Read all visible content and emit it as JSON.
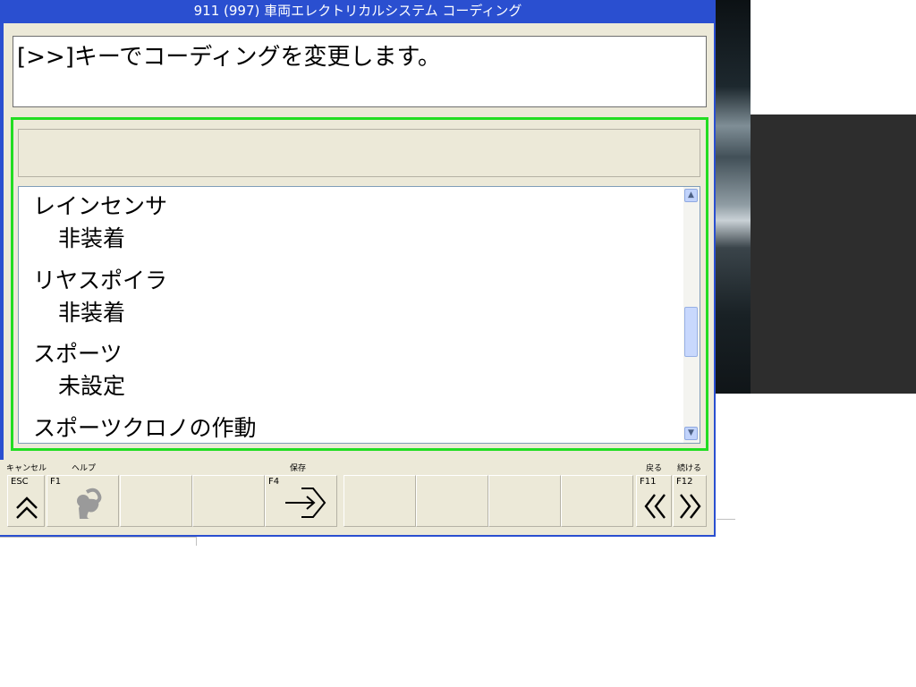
{
  "window": {
    "title": "911 (997) 車両エレクトリカルシステム コーディング"
  },
  "message": "[>>]キーでコーディングを変更します。",
  "list": {
    "items": [
      {
        "name": "レインセンサ",
        "value": "非装着"
      },
      {
        "name": "リヤスポイラ",
        "value": "非装着"
      },
      {
        "name": "スポーツ",
        "value": "未設定"
      },
      {
        "name": "スポーツクロノの作動",
        "value": ""
      }
    ]
  },
  "function_keys": {
    "esc": {
      "top_label": "キャンセル",
      "key": "ESC",
      "icon": "double-chevron-up-icon"
    },
    "f1": {
      "top_label": "ヘルプ",
      "key": "F1",
      "icon": "help-figure-icon"
    },
    "f4": {
      "top_label": "保存",
      "key": "F4",
      "icon": "save-arrow-icon"
    },
    "f11": {
      "top_label": "戻る",
      "key": "F11",
      "icon": "double-chevron-left-icon"
    },
    "f12": {
      "top_label": "続ける",
      "key": "F12",
      "icon": "double-chevron-right-icon"
    }
  },
  "colors": {
    "titlebar": "#2a4fd0",
    "panel_border": "#22dd22",
    "face": "#ece9d8"
  }
}
